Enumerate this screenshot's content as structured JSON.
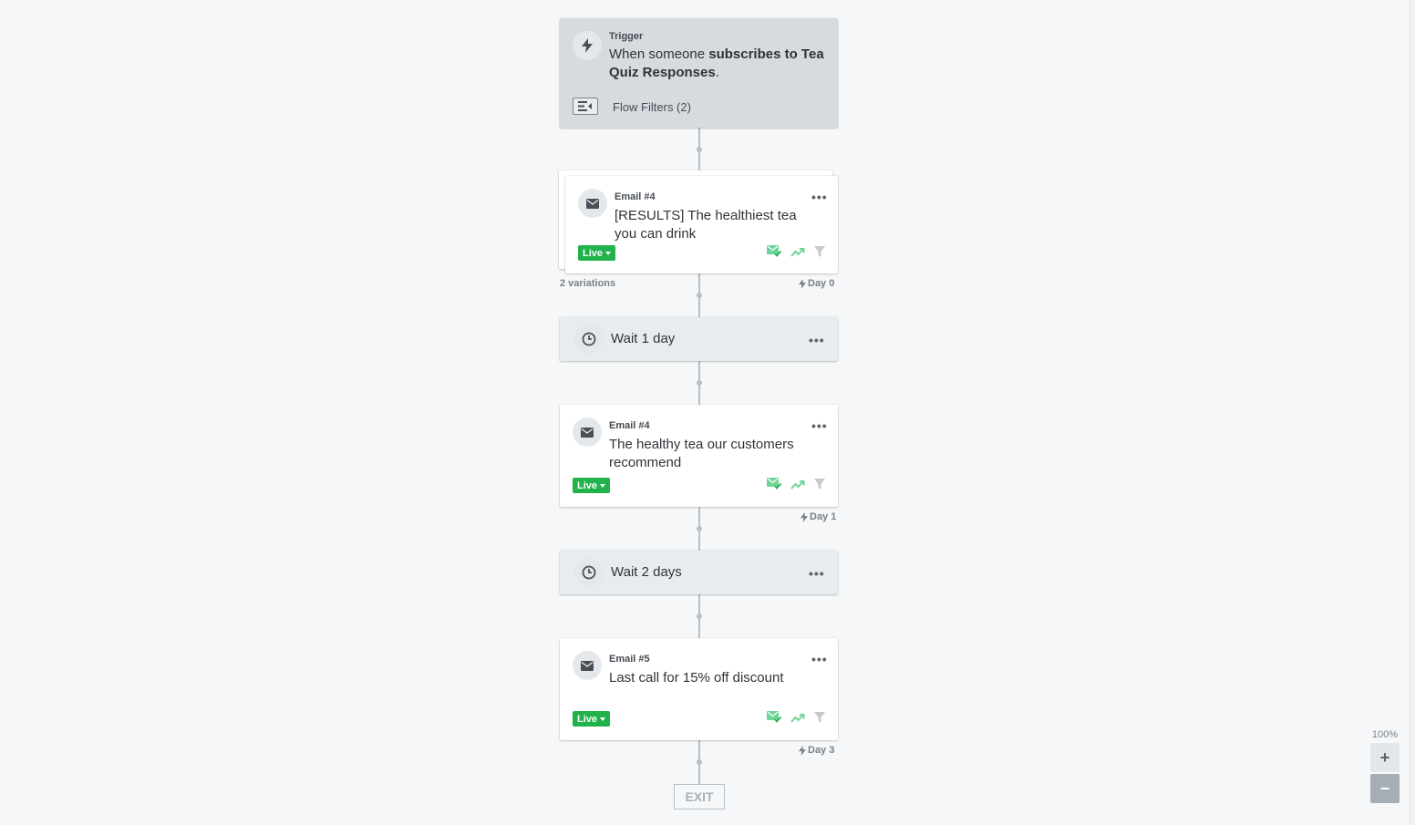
{
  "trigger": {
    "kicker": "Trigger",
    "title_prefix": "When someone ",
    "title_bold": "subscribes to Tea Quiz Responses",
    "title_suffix": ".",
    "filters_label": "Flow Filters (2)"
  },
  "email1": {
    "kicker": "Email #4",
    "title": "[RESULTS] The healthiest tea you can drink",
    "status": "Live",
    "variations_label": "2 variations",
    "day_label": "Day 0"
  },
  "wait1": {
    "label": "Wait 1 day"
  },
  "email2": {
    "kicker": "Email #4",
    "title": "The healthy tea our customers recommend",
    "status": "Live",
    "day_label": "Day 1"
  },
  "wait2": {
    "label": "Wait 2 days"
  },
  "email3": {
    "kicker": "Email #5",
    "title": "Last call for 15% off discount",
    "status": "Live",
    "day_label": "Day 3"
  },
  "exit_label": "EXIT",
  "zoom": {
    "level": "100%",
    "in_label": "+",
    "out_label": "−"
  },
  "more_label": "•••",
  "colors": {
    "live_green": "#22b24c",
    "status_icon_green": "#6fd39a",
    "canvas_bg": "#f5f7f9"
  },
  "icons": [
    "lightning-icon",
    "flow-filter-icon",
    "mail-icon",
    "clock-icon",
    "more-icon",
    "sent-check-icon",
    "trend-icon",
    "filter-icon"
  ]
}
